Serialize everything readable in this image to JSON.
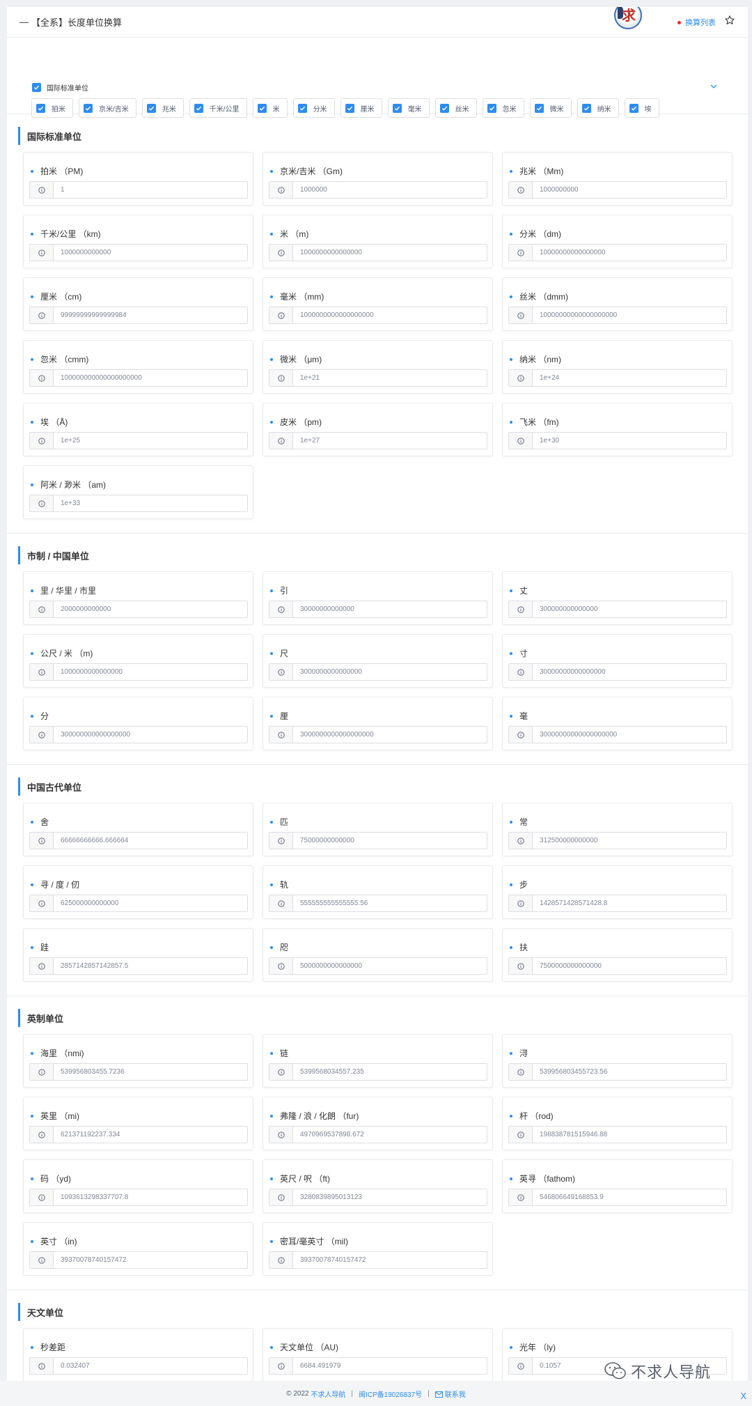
{
  "header": {
    "dash": "—",
    "title": "【全系】长度单位换算",
    "link_label": "换算列表"
  },
  "filter": {
    "group_label": "国际标准单位",
    "chips": [
      "拍米",
      "京米/吉米",
      "兆米",
      "千米/公里",
      "米",
      "分米",
      "厘米",
      "毫米",
      "丝米",
      "忽米",
      "微米",
      "纳米",
      "埃"
    ]
  },
  "sections": [
    {
      "title": "国际标准单位",
      "cards": [
        {
          "label": "拍米 （PM)",
          "value": "1"
        },
        {
          "label": "京米/吉米 （Gm)",
          "value": "1000000"
        },
        {
          "label": "兆米 （Mm)",
          "value": "1000000000"
        },
        {
          "label": "千米/公里 （km)",
          "value": "1000000000000"
        },
        {
          "label": "米 （m)",
          "value": "1000000000000000"
        },
        {
          "label": "分米 （dm)",
          "value": "10000000000000000"
        },
        {
          "label": "厘米 （cm)",
          "value": "99999999999999984"
        },
        {
          "label": "毫米 （mm)",
          "value": "1000000000000000000"
        },
        {
          "label": "丝米 （dmm)",
          "value": "10000000000000000000"
        },
        {
          "label": "忽米 （cmm)",
          "value": "100000000000000000000"
        },
        {
          "label": "微米 （μm)",
          "value": "1e+21"
        },
        {
          "label": "纳米 （nm)",
          "value": "1e+24"
        },
        {
          "label": "埃 （Å)",
          "value": "1e+25"
        },
        {
          "label": "皮米 （pm)",
          "value": "1e+27"
        },
        {
          "label": "飞米 （fm)",
          "value": "1e+30"
        },
        {
          "label": "阿米 / 渺米 （am)",
          "value": "1e+33"
        }
      ]
    },
    {
      "title": "市制 / 中国单位",
      "cards": [
        {
          "label": "里 / 华里 / 市里",
          "value": "2000000000000"
        },
        {
          "label": "引",
          "value": "30000000000000"
        },
        {
          "label": "丈",
          "value": "300000000000000"
        },
        {
          "label": "公尺 / 米 （m)",
          "value": "1000000000000000"
        },
        {
          "label": "尺",
          "value": "3000000000000000"
        },
        {
          "label": "寸",
          "value": "30000000000000000"
        },
        {
          "label": "分",
          "value": "300000000000000000"
        },
        {
          "label": "厘",
          "value": "3000000000000000000"
        },
        {
          "label": "毫",
          "value": "30000000000000000000"
        }
      ]
    },
    {
      "title": "中国古代单位",
      "cards": [
        {
          "label": "舍",
          "value": "66666666666.666664"
        },
        {
          "label": "匹",
          "value": "75000000000000"
        },
        {
          "label": "常",
          "value": "312500000000000"
        },
        {
          "label": "寻 / 度 / 仞",
          "value": "625000000000000"
        },
        {
          "label": "轨",
          "value": "555555555555555.56"
        },
        {
          "label": "步",
          "value": "1428571428571428.8"
        },
        {
          "label": "跬",
          "value": "2857142857142857.5"
        },
        {
          "label": "咫",
          "value": "5000000000000000"
        },
        {
          "label": "扶",
          "value": "7500000000000000"
        }
      ]
    },
    {
      "title": "英制单位",
      "cards": [
        {
          "label": "海里 （nmi)",
          "value": "539956803455.7236"
        },
        {
          "label": "链",
          "value": "5399568034557.235"
        },
        {
          "label": "浔",
          "value": "539956803455723.56"
        },
        {
          "label": "英里 （mi)",
          "value": "621371192237.334"
        },
        {
          "label": "弗隆 / 浪 / 化朗 （fur)",
          "value": "4970969537898.672"
        },
        {
          "label": "杆 （rod)",
          "value": "198838781515946.88"
        },
        {
          "label": "码 （yd)",
          "value": "1093613298337707.8"
        },
        {
          "label": "英尺 / 呎 （ft)",
          "value": "3280839895013123"
        },
        {
          "label": "英寻 （fathom)",
          "value": "546806649168853.9"
        },
        {
          "label": "英寸 （in)",
          "value": "39370078740157472"
        },
        {
          "label": "密耳/毫英寸 （mil)",
          "value": "39370078740157472"
        }
      ]
    },
    {
      "title": "天文单位",
      "cards": [
        {
          "label": "秒差距",
          "value": "0.032407"
        },
        {
          "label": "天文单位 （AU)",
          "value": "6684.491979"
        },
        {
          "label": "光年 （ly)",
          "value": "0.1057"
        }
      ]
    }
  ],
  "footer": {
    "copyright": "© 2022",
    "site": "不求人导航",
    "icp": "闽ICP备19026837号",
    "contact": "联系我"
  },
  "watermark": "不求人导航",
  "close_label": "X",
  "colors": {
    "accent": "#2d8cf0",
    "dot_red": "#e0332b"
  }
}
